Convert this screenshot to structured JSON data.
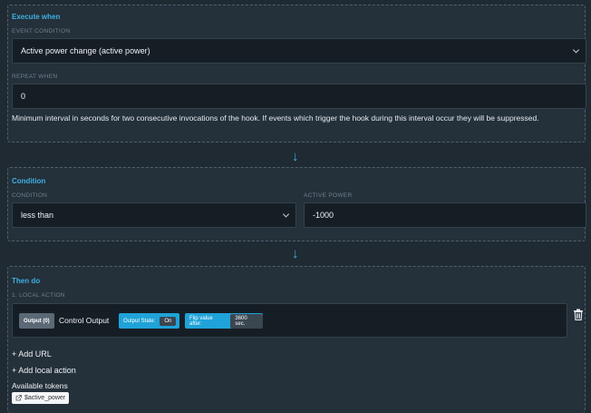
{
  "execute_when": {
    "title": "Execute when",
    "event_condition_label": "EVENT CONDITION",
    "event_condition_value": "Active power change (active power)",
    "repeat_when_label": "REPEAT WHEN",
    "repeat_when_value": "0",
    "help_text": "Minimum interval in seconds for two consecutive invocations of the hook. If events which trigger the hook during this interval occur they will be suppressed."
  },
  "arrow_glyph": "↓",
  "condition": {
    "title": "Condition",
    "condition_label": "CONDITION",
    "condition_value": "less than",
    "active_power_label": "ACTIVE POWER",
    "active_power_value": "-1000"
  },
  "then_do": {
    "title": "Then do",
    "local_action_label": "1. LOCAL ACTION",
    "output_badge": "Output (0)",
    "action_text": "Control Output",
    "output_state_label": "Output State:",
    "output_state_value": "On",
    "flip_label": "Flip value after:",
    "flip_value": "3600 sec.",
    "add_url": "+ Add URL",
    "add_local_action": "+ Add local action",
    "available_tokens_label": "Available tokens",
    "tokens": [
      "$active_power"
    ]
  },
  "colors": {
    "accent": "#3fb0e0",
    "chip": "#1fa3d8",
    "background": "#1f2a33"
  },
  "icons": {
    "delete": "trash-icon",
    "token": "external-link-icon",
    "dropdown": "chevron-down-icon"
  }
}
